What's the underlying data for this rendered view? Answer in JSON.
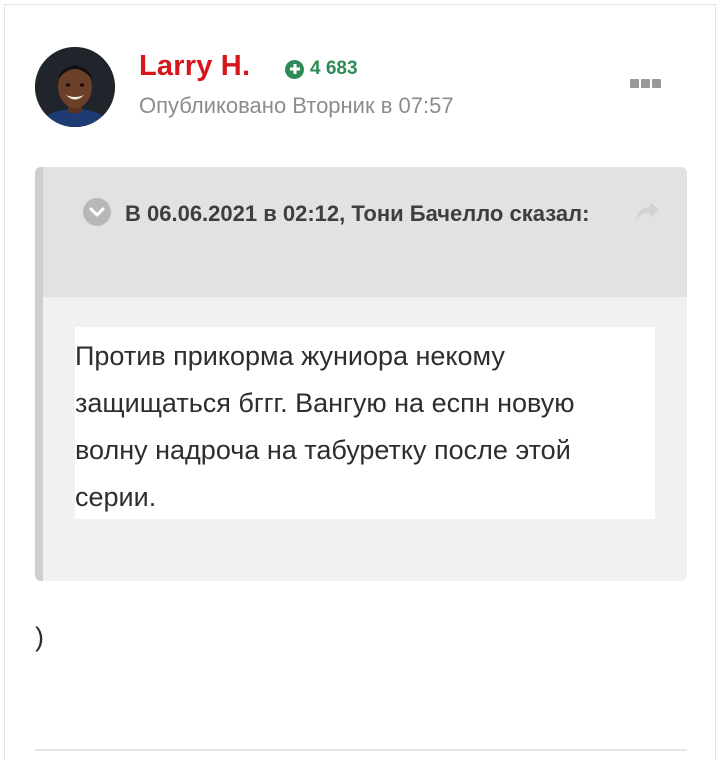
{
  "post": {
    "author": {
      "name": "Larry H.",
      "avatar_icon": "user-avatar-photo"
    },
    "reputation": {
      "icon": "plus-circle-icon",
      "value": "4 683",
      "color": "#2e8b57"
    },
    "meta": "Опубликовано Вторник в 07:57",
    "more_icon": "ellipsis-icon",
    "quote": {
      "citation": "В 06.06.2021 в 02:12, Тони Бачелло сказал:",
      "toggle_icon": "chevron-down-icon",
      "share_icon": "share-arrow-icon",
      "text": "Против прикорма жуниора некому защищаться бггг. Вангую на еспн новую волну надроча на табуретку после этой серии."
    },
    "text": ")"
  },
  "colors": {
    "author_name": "#d6161b",
    "meta_text": "#8c8c8c",
    "quote_background": "#f1f1f1",
    "quote_header_background": "#e2e2e2"
  }
}
